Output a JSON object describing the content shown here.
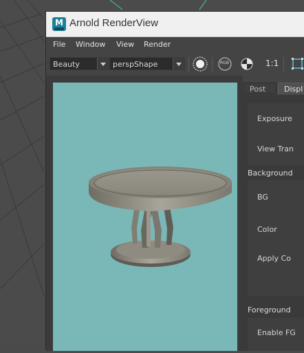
{
  "window": {
    "title": "Arnold RenderView",
    "app_icon_letter": "M"
  },
  "menu": [
    "File",
    "Window",
    "View",
    "Render"
  ],
  "toolbar": {
    "aov_value": "Beauty",
    "camera_value": "perspShape",
    "rgb_label": "RGB",
    "ratio_label": "1:1"
  },
  "tabs": {
    "post": "Post",
    "display": "Displ"
  },
  "panel": {
    "exposure_label": "Exposure",
    "view_transform_label": "View Tran",
    "background_header": "Background",
    "bg_label": "BG",
    "color_label": "Color",
    "apply_label": "Apply Co",
    "foreground_header": "Foreground",
    "enable_fg_label": "Enable FG"
  },
  "colors": {
    "render_bg": "#7ab8b8",
    "window_bg": "#444444",
    "titlebar": "#f0f0f0"
  }
}
